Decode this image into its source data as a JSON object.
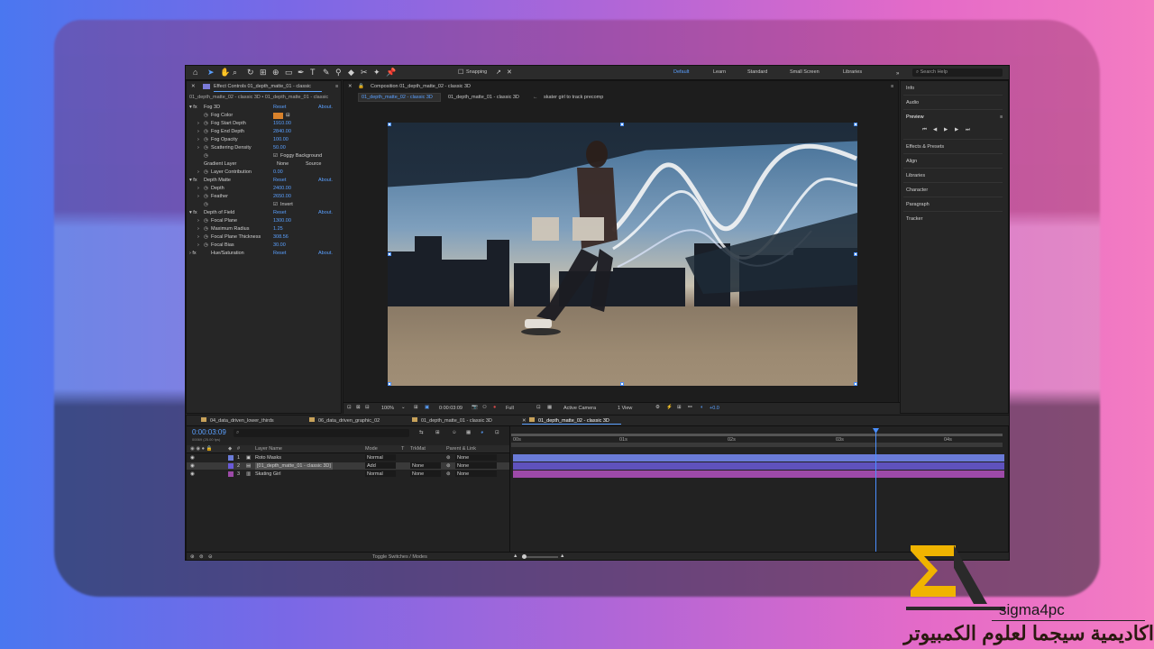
{
  "colors": {
    "accent": "#5aa0ff",
    "brand_gold": "#f0b400",
    "layer1": "#6a7bd8",
    "layer2": "#6a5ad8",
    "layer3": "#9d4aa8"
  },
  "toolbar": {
    "snapping": "Snapping",
    "workspaces": [
      "Default",
      "Learn",
      "Standard",
      "Small Screen",
      "Libraries"
    ],
    "search_placeholder": "Search Help"
  },
  "effect_controls": {
    "tab": "Effect Controls 01_depth_matte_01 - classic",
    "subtitle": "01_depth_matte_02 - classic 3D • 01_depth_matte_01 - classic",
    "rows": [
      {
        "label": "Fog 3D",
        "value": "Reset",
        "right": "About."
      },
      {
        "label": "Fog Color",
        "value": "",
        "right": ""
      },
      {
        "label": "Fog Start Depth",
        "value": "1910.00",
        "right": ""
      },
      {
        "label": "Fog End Depth",
        "value": "2840.00",
        "right": ""
      },
      {
        "label": "Fog Opacity",
        "value": "100.00",
        "right": ""
      },
      {
        "label": "Scattering Density",
        "value": "50.00",
        "right": ""
      },
      {
        "label": "",
        "value": "Foggy Background",
        "right": ""
      },
      {
        "label": "Gradient Layer",
        "value": "None",
        "right": "Source"
      },
      {
        "label": "Layer Contribution",
        "value": "0.00",
        "right": ""
      },
      {
        "label": "Depth Matte",
        "value": "Reset",
        "right": "About."
      },
      {
        "label": "Depth",
        "value": "2400.00",
        "right": ""
      },
      {
        "label": "Feather",
        "value": "2650.00",
        "right": ""
      },
      {
        "label": "",
        "value": "Invert",
        "right": ""
      },
      {
        "label": "Depth of Field",
        "value": "Reset",
        "right": "About."
      },
      {
        "label": "Focal Plane",
        "value": "1300.00",
        "right": ""
      },
      {
        "label": "Maximum Radius",
        "value": "1.25",
        "right": ""
      },
      {
        "label": "Focal Plane Thickness",
        "value": "308.56",
        "right": ""
      },
      {
        "label": "Focal Bias",
        "value": "30.00",
        "right": ""
      },
      {
        "label": "Hue/Saturation",
        "value": "Reset",
        "right": "About."
      }
    ]
  },
  "composition": {
    "tab": "Composition 01_depth_matte_02 - classic 3D",
    "subtabs": [
      "01_depth_matte_02 - classic 3D",
      "01_depth_matte_01 - classic 3D",
      "skater girl to track precomp"
    ],
    "footer": {
      "zoom": "100%",
      "time": "0:00:03:09",
      "res": "Full",
      "camera": "Active Camera",
      "view": "1 View",
      "exposure": "+0.0"
    }
  },
  "right_panel": {
    "items": [
      "Info",
      "Audio",
      "Preview",
      "Effects & Presets",
      "Align",
      "Libraries",
      "Character",
      "Paragraph",
      "Tracker"
    ]
  },
  "timeline": {
    "tabs": [
      "04_data_driven_lower_thirds",
      "06_data_driven_graphic_02",
      "01_depth_matte_01 - classic 3D",
      "01_depth_matte_02 - classic 3D"
    ],
    "timecode": "0:00:03:09",
    "fps": "00069 (25.00 fps)",
    "columns": {
      "name": "Layer Name",
      "mode": "Mode",
      "t": "T",
      "trkmat": "TrkMat",
      "parent": "Parent & Link"
    },
    "layers": [
      {
        "num": "1",
        "name": "Roto Masks",
        "mode": "Normal",
        "trkmat": "",
        "parent": "None"
      },
      {
        "num": "2",
        "name": "[01_depth_matte_01 - classic 3D]",
        "mode": "Add",
        "trkmat": "None",
        "parent": "None"
      },
      {
        "num": "3",
        "name": "Skating Girl",
        "mode": "Normal",
        "trkmat": "None",
        "parent": "None"
      }
    ],
    "footer": "Toggle Switches / Modes",
    "ruler": [
      "00s",
      "01s",
      "02s",
      "03s",
      "04s"
    ]
  },
  "branding": {
    "name": "sigma4pc",
    "arabic": "اكاديمية سيجما لعلوم الكمبيوتر"
  }
}
